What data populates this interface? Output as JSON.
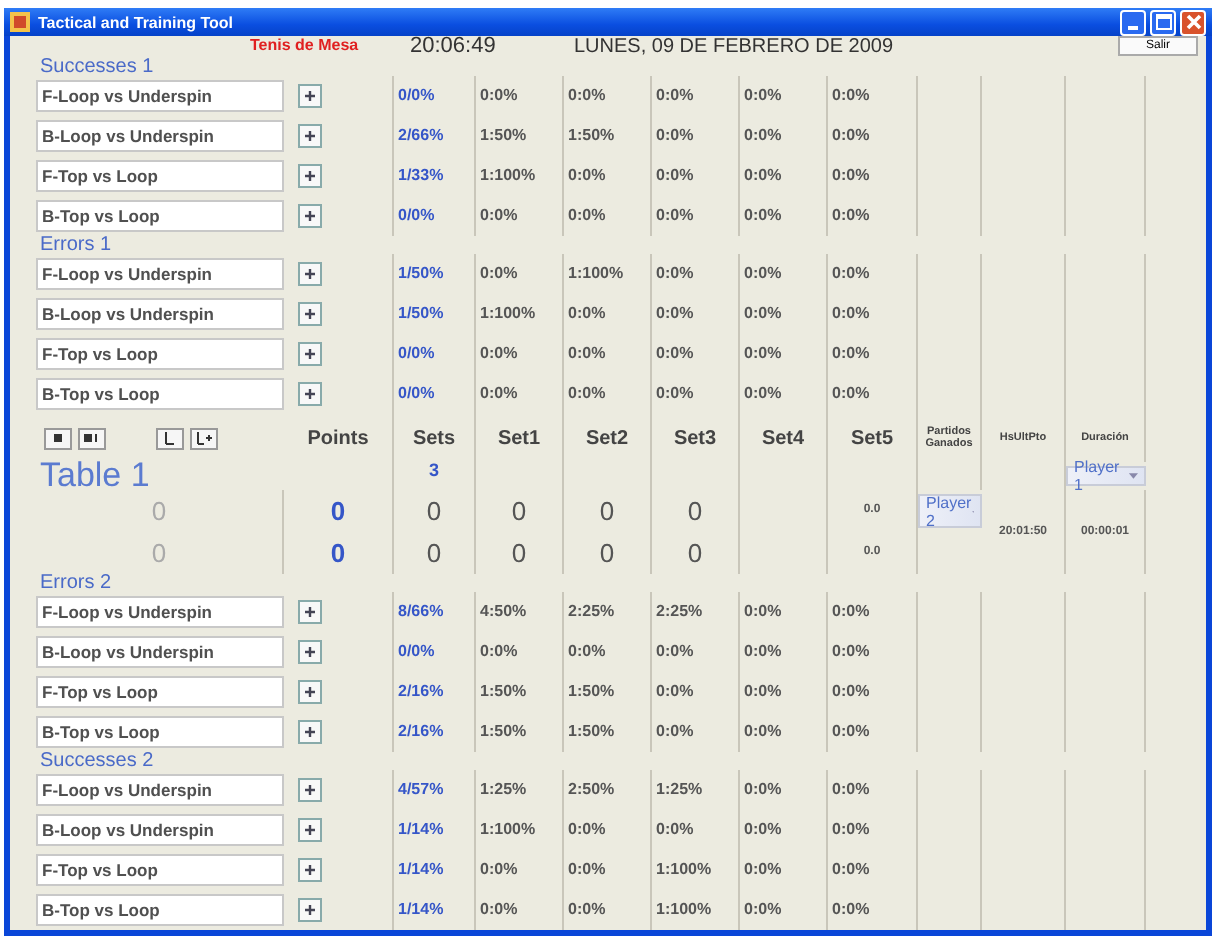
{
  "window": {
    "title": "Tactical and Training Tool"
  },
  "header": {
    "sport": "Tenis de Mesa",
    "time": "20:06:49",
    "date": "LUNES, 09 DE FEBRERO DE 2009",
    "exit_button": "Salir"
  },
  "panels": [
    {
      "kind": "stats",
      "title": "Successes 1",
      "rows": [
        {
          "label": "F-Loop vs Underspin",
          "total": "0/0%",
          "sets": [
            "0:0%",
            "0:0%",
            "0:0%",
            "0:0%",
            "0:0%"
          ]
        },
        {
          "label": "B-Loop vs Underspin",
          "total": "2/66%",
          "sets": [
            "1:50%",
            "1:50%",
            "0:0%",
            "0:0%",
            "0:0%"
          ]
        },
        {
          "label": "F-Top vs Loop",
          "total": "1/33%",
          "sets": [
            "1:100%",
            "0:0%",
            "0:0%",
            "0:0%",
            "0:0%"
          ]
        },
        {
          "label": "B-Top vs Loop",
          "total": "0/0%",
          "sets": [
            "0:0%",
            "0:0%",
            "0:0%",
            "0:0%",
            "0:0%"
          ]
        }
      ]
    },
    {
      "kind": "stats",
      "title": "Errors 1",
      "rows": [
        {
          "label": "F-Loop vs Underspin",
          "total": "1/50%",
          "sets": [
            "0:0%",
            "1:100%",
            "0:0%",
            "0:0%",
            "0:0%"
          ]
        },
        {
          "label": "B-Loop vs Underspin",
          "total": "1/50%",
          "sets": [
            "1:100%",
            "0:0%",
            "0:0%",
            "0:0%",
            "0:0%"
          ]
        },
        {
          "label": "F-Top vs Loop",
          "total": "0/0%",
          "sets": [
            "0:0%",
            "0:0%",
            "0:0%",
            "0:0%",
            "0:0%"
          ]
        },
        {
          "label": "B-Top vs Loop",
          "total": "0/0%",
          "sets": [
            "0:0%",
            "0:0%",
            "0:0%",
            "0:0%",
            "0:0%"
          ]
        }
      ]
    },
    {
      "kind": "scoreboard",
      "columns": [
        "Points",
        "Sets",
        "Set1",
        "Set2",
        "Set3",
        "Set4",
        "Set5",
        "Partidos Ganados",
        "HsUltPto",
        "Duración"
      ],
      "sets_count": "3",
      "table": "Table 1",
      "last_point": "20:01:50",
      "duration": "00:00:01",
      "players": [
        {
          "name": "Player 1",
          "points": "0",
          "sets": "0",
          "set_scores": [
            "0",
            "0",
            "0",
            "0"
          ],
          "matches": "0.0"
        },
        {
          "name": "Player 2",
          "points": "0",
          "sets": "0",
          "set_scores": [
            "0",
            "0",
            "0",
            "0"
          ],
          "matches": "0.0"
        }
      ]
    },
    {
      "kind": "stats",
      "title": "Errors 2",
      "rows": [
        {
          "label": "F-Loop vs Underspin",
          "total": "8/66%",
          "sets": [
            "4:50%",
            "2:25%",
            "2:25%",
            "0:0%",
            "0:0%"
          ]
        },
        {
          "label": "B-Loop vs Underspin",
          "total": "0/0%",
          "sets": [
            "0:0%",
            "0:0%",
            "0:0%",
            "0:0%",
            "0:0%"
          ]
        },
        {
          "label": "F-Top vs Loop",
          "total": "2/16%",
          "sets": [
            "1:50%",
            "1:50%",
            "0:0%",
            "0:0%",
            "0:0%"
          ]
        },
        {
          "label": "B-Top vs Loop",
          "total": "2/16%",
          "sets": [
            "1:50%",
            "1:50%",
            "0:0%",
            "0:0%",
            "0:0%"
          ]
        }
      ]
    },
    {
      "kind": "stats",
      "title": "Successes 2",
      "rows": [
        {
          "label": "F-Loop vs Underspin",
          "total": "4/57%",
          "sets": [
            "1:25%",
            "2:50%",
            "1:25%",
            "0:0%",
            "0:0%"
          ]
        },
        {
          "label": "B-Loop vs Underspin",
          "total": "1/14%",
          "sets": [
            "1:100%",
            "0:0%",
            "0:0%",
            "0:0%",
            "0:0%"
          ]
        },
        {
          "label": "F-Top vs Loop",
          "total": "1/14%",
          "sets": [
            "0:0%",
            "0:0%",
            "1:100%",
            "0:0%",
            "0:0%"
          ]
        },
        {
          "label": "B-Top vs Loop",
          "total": "1/14%",
          "sets": [
            "0:0%",
            "0:0%",
            "1:100%",
            "0:0%",
            "0:0%"
          ]
        }
      ]
    }
  ]
}
